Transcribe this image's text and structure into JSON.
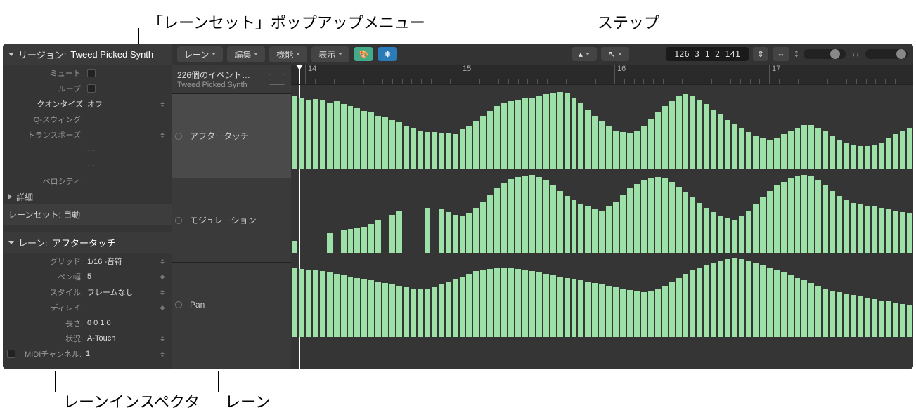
{
  "callouts": {
    "laneset_popup": "「レーンセット」ポップアップメニュー",
    "step": "ステップ",
    "lane_inspector": "レーンインスペクタ",
    "lane": "レーン"
  },
  "inspector": {
    "region_header_prefix": "リージョン:",
    "region_name": "Tweed Picked Synth",
    "mute": "ミュート:",
    "loop": "ループ:",
    "quantize_label": "クオンタイズ",
    "quantize_value": "オフ",
    "qswing": "Q-スウィング:",
    "transpose": "トランスポーズ:",
    "dash1": "- -",
    "dash2": "- -",
    "velocity": "ベロシティ:",
    "advanced": "詳細",
    "laneset_label": "レーンセット:",
    "laneset_value": "自動",
    "lane_header_prefix": "レーン:",
    "lane_name": "アフタータッチ",
    "grid_label": "グリッド:",
    "grid_value": "1/16 -音符",
    "penwidth_label": "ペン幅:",
    "penwidth_value": "5",
    "style_label": "スタイル:",
    "style_value": "フレームなし",
    "delay_label": "ディレイ:",
    "length_label": "長さ:",
    "length_value": "0 0 1    0",
    "status_label": "状況:",
    "status_value": "A-Touch",
    "midich_label": "MIDIチャンネル:",
    "midich_value": "1"
  },
  "toolbar": {
    "lane": "レーン",
    "edit": "編集",
    "func": "機能",
    "view": "表示",
    "locator": "126  3 1 2 141"
  },
  "events": {
    "title": "226個のイベント…",
    "subtitle": "Tweed Picked Synth"
  },
  "lanes": [
    {
      "name": "アフタータッチ",
      "height": 120
    },
    {
      "name": "モジュレーション",
      "height": 120
    },
    {
      "name": "Pan",
      "height": 120
    }
  ],
  "ruler": {
    "marks": [
      {
        "pos": 20,
        "label": "14"
      },
      {
        "pos": 240,
        "label": "15"
      },
      {
        "pos": 460,
        "label": "16"
      },
      {
        "pos": 680,
        "label": "17"
      }
    ]
  },
  "chart_data": [
    {
      "type": "bar",
      "name": "アフタータッチ",
      "values": [
        110,
        108,
        105,
        106,
        104,
        100,
        102,
        98,
        95,
        92,
        88,
        85,
        80,
        78,
        74,
        70,
        65,
        62,
        58,
        56,
        55,
        54,
        53,
        52,
        60,
        65,
        72,
        80,
        88,
        95,
        100,
        103,
        105,
        107,
        108,
        110,
        113,
        115,
        116,
        115,
        108,
        100,
        90,
        80,
        72,
        64,
        58,
        55,
        53,
        58,
        65,
        75,
        85,
        95,
        103,
        110,
        113,
        110,
        105,
        98,
        90,
        82,
        74,
        68,
        62,
        55,
        50,
        46,
        44,
        46,
        52,
        58,
        62,
        66,
        66,
        62,
        58,
        50,
        44,
        40,
        36,
        34,
        34,
        36,
        40,
        46,
        52,
        58,
        62
      ],
      "ylim": [
        0,
        127
      ]
    },
    {
      "type": "bar",
      "name": "モジュレーション",
      "values": [
        18,
        0,
        0,
        0,
        0,
        30,
        0,
        34,
        36,
        38,
        40,
        44,
        50,
        0,
        58,
        64,
        0,
        0,
        0,
        68,
        0,
        66,
        62,
        58,
        56,
        60,
        68,
        78,
        88,
        98,
        106,
        112,
        115,
        117,
        118,
        115,
        110,
        102,
        94,
        86,
        80,
        74,
        70,
        66,
        64,
        70,
        78,
        88,
        98,
        105,
        110,
        113,
        115,
        113,
        108,
        100,
        92,
        84,
        76,
        68,
        62,
        56,
        52,
        50,
        56,
        64,
        74,
        84,
        94,
        102,
        108,
        113,
        116,
        118,
        116,
        110,
        102,
        94,
        86,
        80,
        76,
        74,
        72,
        70,
        68,
        66,
        64,
        62,
        60
      ],
      "ylim": [
        0,
        127
      ]
    },
    {
      "type": "bar",
      "name": "Pan",
      "values": [
        105,
        104,
        103,
        102,
        100,
        98,
        96,
        94,
        92,
        90,
        88,
        86,
        84,
        82,
        80,
        78,
        76,
        74,
        74,
        74,
        76,
        80,
        84,
        88,
        92,
        96,
        100,
        102,
        104,
        105,
        106,
        105,
        104,
        102,
        100,
        98,
        96,
        94,
        92,
        90,
        88,
        86,
        84,
        82,
        80,
        78,
        76,
        74,
        72,
        70,
        68,
        70,
        74,
        78,
        84,
        90,
        96,
        102,
        106,
        110,
        113,
        116,
        118,
        120,
        118,
        116,
        113,
        110,
        106,
        102,
        98,
        94,
        90,
        86,
        82,
        78,
        74,
        70,
        68,
        66,
        64,
        62,
        60,
        58,
        56,
        54,
        52,
        50,
        48
      ],
      "ylim": [
        0,
        127
      ]
    }
  ]
}
